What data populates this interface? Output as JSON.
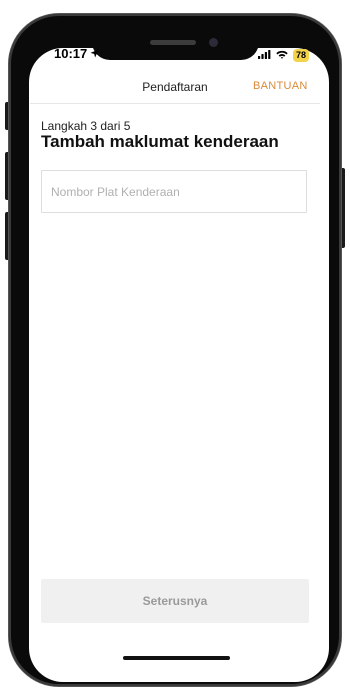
{
  "status_bar": {
    "time": "10:17",
    "battery": "78"
  },
  "header": {
    "title": "Pendaftaran",
    "help_label": "BANTUAN"
  },
  "main": {
    "step": "Langkah 3 dari 5",
    "heading": "Tambah maklumat kenderaan",
    "plate_input": {
      "value": "",
      "placeholder": "Nombor Plat Kenderaan"
    },
    "next_label": "Seterusnya"
  },
  "colors": {
    "accent": "#d98b3a",
    "battery": "#f2d34a",
    "button_disabled_bg": "#f0f0f0",
    "button_disabled_text": "#9a9a9a"
  },
  "icons": [
    "location-arrow-icon",
    "signal-icon",
    "wifi-icon",
    "battery-icon"
  ]
}
